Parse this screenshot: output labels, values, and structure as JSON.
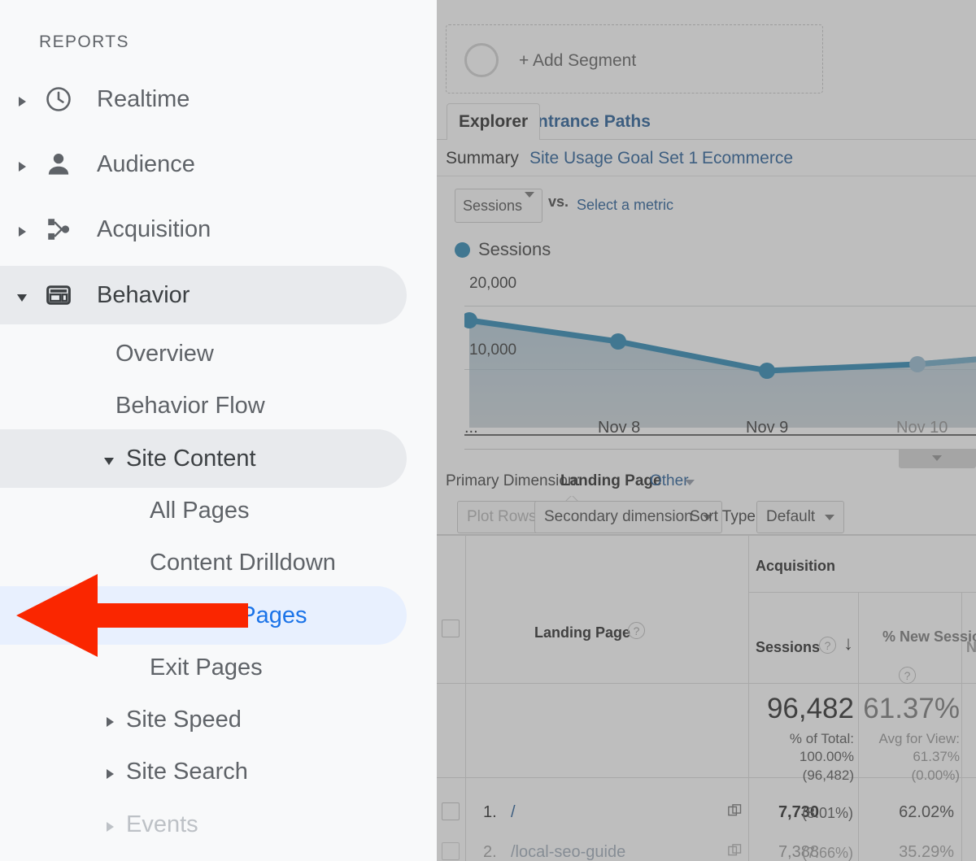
{
  "sidebar": {
    "section_label": "REPORTS",
    "items": [
      {
        "label": "Realtime",
        "icon": "clock-icon",
        "level": 1,
        "state": "collapsed",
        "caret": "right"
      },
      {
        "label": "Audience",
        "icon": "person-icon",
        "level": 1,
        "state": "collapsed",
        "caret": "right"
      },
      {
        "label": "Acquisition",
        "icon": "acquisition-node-icon",
        "level": 1,
        "state": "collapsed",
        "caret": "right"
      },
      {
        "label": "Behavior",
        "icon": "page-layout-icon",
        "level": 1,
        "state": "expanded-selected",
        "caret": "down"
      },
      {
        "label": "Overview",
        "level": 2,
        "state": "normal"
      },
      {
        "label": "Behavior Flow",
        "level": 2,
        "state": "normal"
      },
      {
        "label": "Site Content",
        "level": 2,
        "state": "expanded-selected",
        "caret": "down"
      },
      {
        "label": "All Pages",
        "level": 3,
        "state": "normal"
      },
      {
        "label": "Content Drilldown",
        "level": 3,
        "state": "normal"
      },
      {
        "label": "Landing Pages",
        "level": 3,
        "state": "active"
      },
      {
        "label": "Exit Pages",
        "level": 3,
        "state": "normal"
      },
      {
        "label": "Site Speed",
        "level": 2,
        "state": "collapsed",
        "caret": "right"
      },
      {
        "label": "Site Search",
        "level": 2,
        "state": "collapsed",
        "caret": "right"
      },
      {
        "label": "Events",
        "level": 2,
        "state": "collapsed-dim",
        "caret": "right"
      }
    ]
  },
  "colors": {
    "accent_blue": "#1a73e8",
    "link_blue": "#15508f",
    "chart_line": "#1c7fae",
    "arrow_red": "#fa2600",
    "selected_gray": "#e8eaed",
    "selected_blue": "#e8f0fe"
  },
  "main": {
    "segment": {
      "label": "+ Add Segment"
    },
    "tabs": [
      {
        "label": "Explorer",
        "active": true
      },
      {
        "label": "Entrance Paths",
        "active": false
      }
    ],
    "subtabs": [
      {
        "label": "Summary",
        "active": true
      },
      {
        "label": "Site Usage",
        "active": false
      },
      {
        "label": "Goal Set 1",
        "active": false
      },
      {
        "label": "Ecommerce",
        "active": false
      }
    ],
    "metric_selector": {
      "value": "Sessions"
    },
    "vs_label": "vs.",
    "select_metric_link": "Select a metric",
    "legend": {
      "label": "Sessions"
    },
    "primary_dimension": {
      "prefix": "Primary Dimension:",
      "value": "Landing Page",
      "other": "Other"
    },
    "controls": {
      "plot_rows": "Plot Rows",
      "secondary_dimension": "Secondary dimension",
      "sort_type_label": "Sort Type:",
      "sort_type_value": "Default"
    },
    "table": {
      "group_header": "Acquisition",
      "columns": [
        {
          "label": "Landing Page",
          "has_help": true
        },
        {
          "label": "Sessions",
          "has_help": true,
          "sorted": "desc"
        },
        {
          "label": "% New Sessions",
          "has_help": true
        },
        {
          "label": "N",
          "has_help": false
        }
      ],
      "summary": {
        "sessions": {
          "value": "96,482",
          "lines": [
            "% of Total:",
            "100.00%",
            "(96,482)"
          ]
        },
        "new_sessions": {
          "value": "61.37%",
          "lines": [
            "Avg for View:",
            "61.37%",
            "(0.00%)"
          ]
        }
      },
      "rows": [
        {
          "index": "1.",
          "landing_page": "/",
          "sessions": "7,730",
          "sessions_pct": "(8.01%)",
          "new_sessions": "62.02%"
        },
        {
          "index": "2.",
          "landing_page": "/local-seo-guide",
          "sessions": "7,388",
          "sessions_pct": "(7.66%)",
          "new_sessions": "35.29%"
        }
      ]
    }
  },
  "chart_data": {
    "type": "line",
    "title": "Sessions",
    "xlabel": "",
    "ylabel": "",
    "x": [
      "...",
      "Nov 8",
      "Nov 9",
      "Nov 10"
    ],
    "categories": [
      "...",
      "Nov 8",
      "Nov 9",
      "Nov 10"
    ],
    "series": [
      {
        "name": "Sessions",
        "values": [
          19500,
          16200,
          11000,
          11300
        ]
      }
    ],
    "ytick_labels": [
      "20,000",
      "10,000"
    ],
    "yticks": [
      20000,
      10000
    ],
    "ylim": [
      0,
      22000
    ],
    "grid": true,
    "legend": "top-left",
    "line_color": "#1c7fae",
    "fill": "area-gradient"
  },
  "annotation": {
    "arrow": {
      "shape": "left-pointing-arrow",
      "color": "#fa2600",
      "points_at": "Landing Pages"
    }
  }
}
